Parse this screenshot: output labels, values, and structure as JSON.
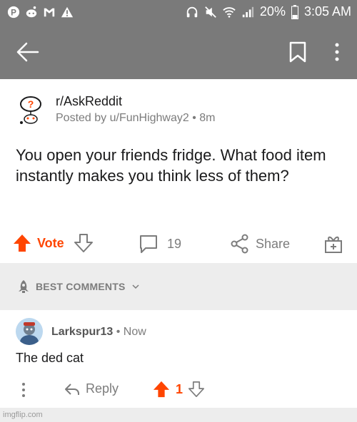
{
  "status_bar": {
    "battery": "20%",
    "time": "3:05 AM",
    "icons": [
      "pinterest-icon",
      "reddit-icon",
      "gmail-icon",
      "warning-icon",
      "headphones-icon",
      "mute-icon",
      "wifi-icon",
      "signal-icon",
      "battery-icon"
    ]
  },
  "app_bar": {
    "back_icon": "back-arrow-icon",
    "bookmark_icon": "bookmark-icon",
    "more_icon": "more-vertical-icon"
  },
  "post": {
    "subreddit": "r/AskReddit",
    "posted_by": "Posted by u/FunHighway2 • 8m",
    "title": "You open your friends fridge. What food item instantly makes you think less of them?",
    "vote_label": "Vote",
    "comments_count": "19",
    "share_label": "Share"
  },
  "sort": {
    "label": "BEST COMMENTS"
  },
  "comment": {
    "username": "Larkspur13",
    "time": " • Now",
    "body": "The ded cat",
    "reply_label": "Reply",
    "score": "1"
  },
  "footer": {
    "watermark": "imgflip.com"
  },
  "colors": {
    "status_bar_bg": "#7a7a7a",
    "upvote_orange": "#ff4500",
    "muted_text": "#7c7c7c",
    "band_gray": "#ededed"
  }
}
